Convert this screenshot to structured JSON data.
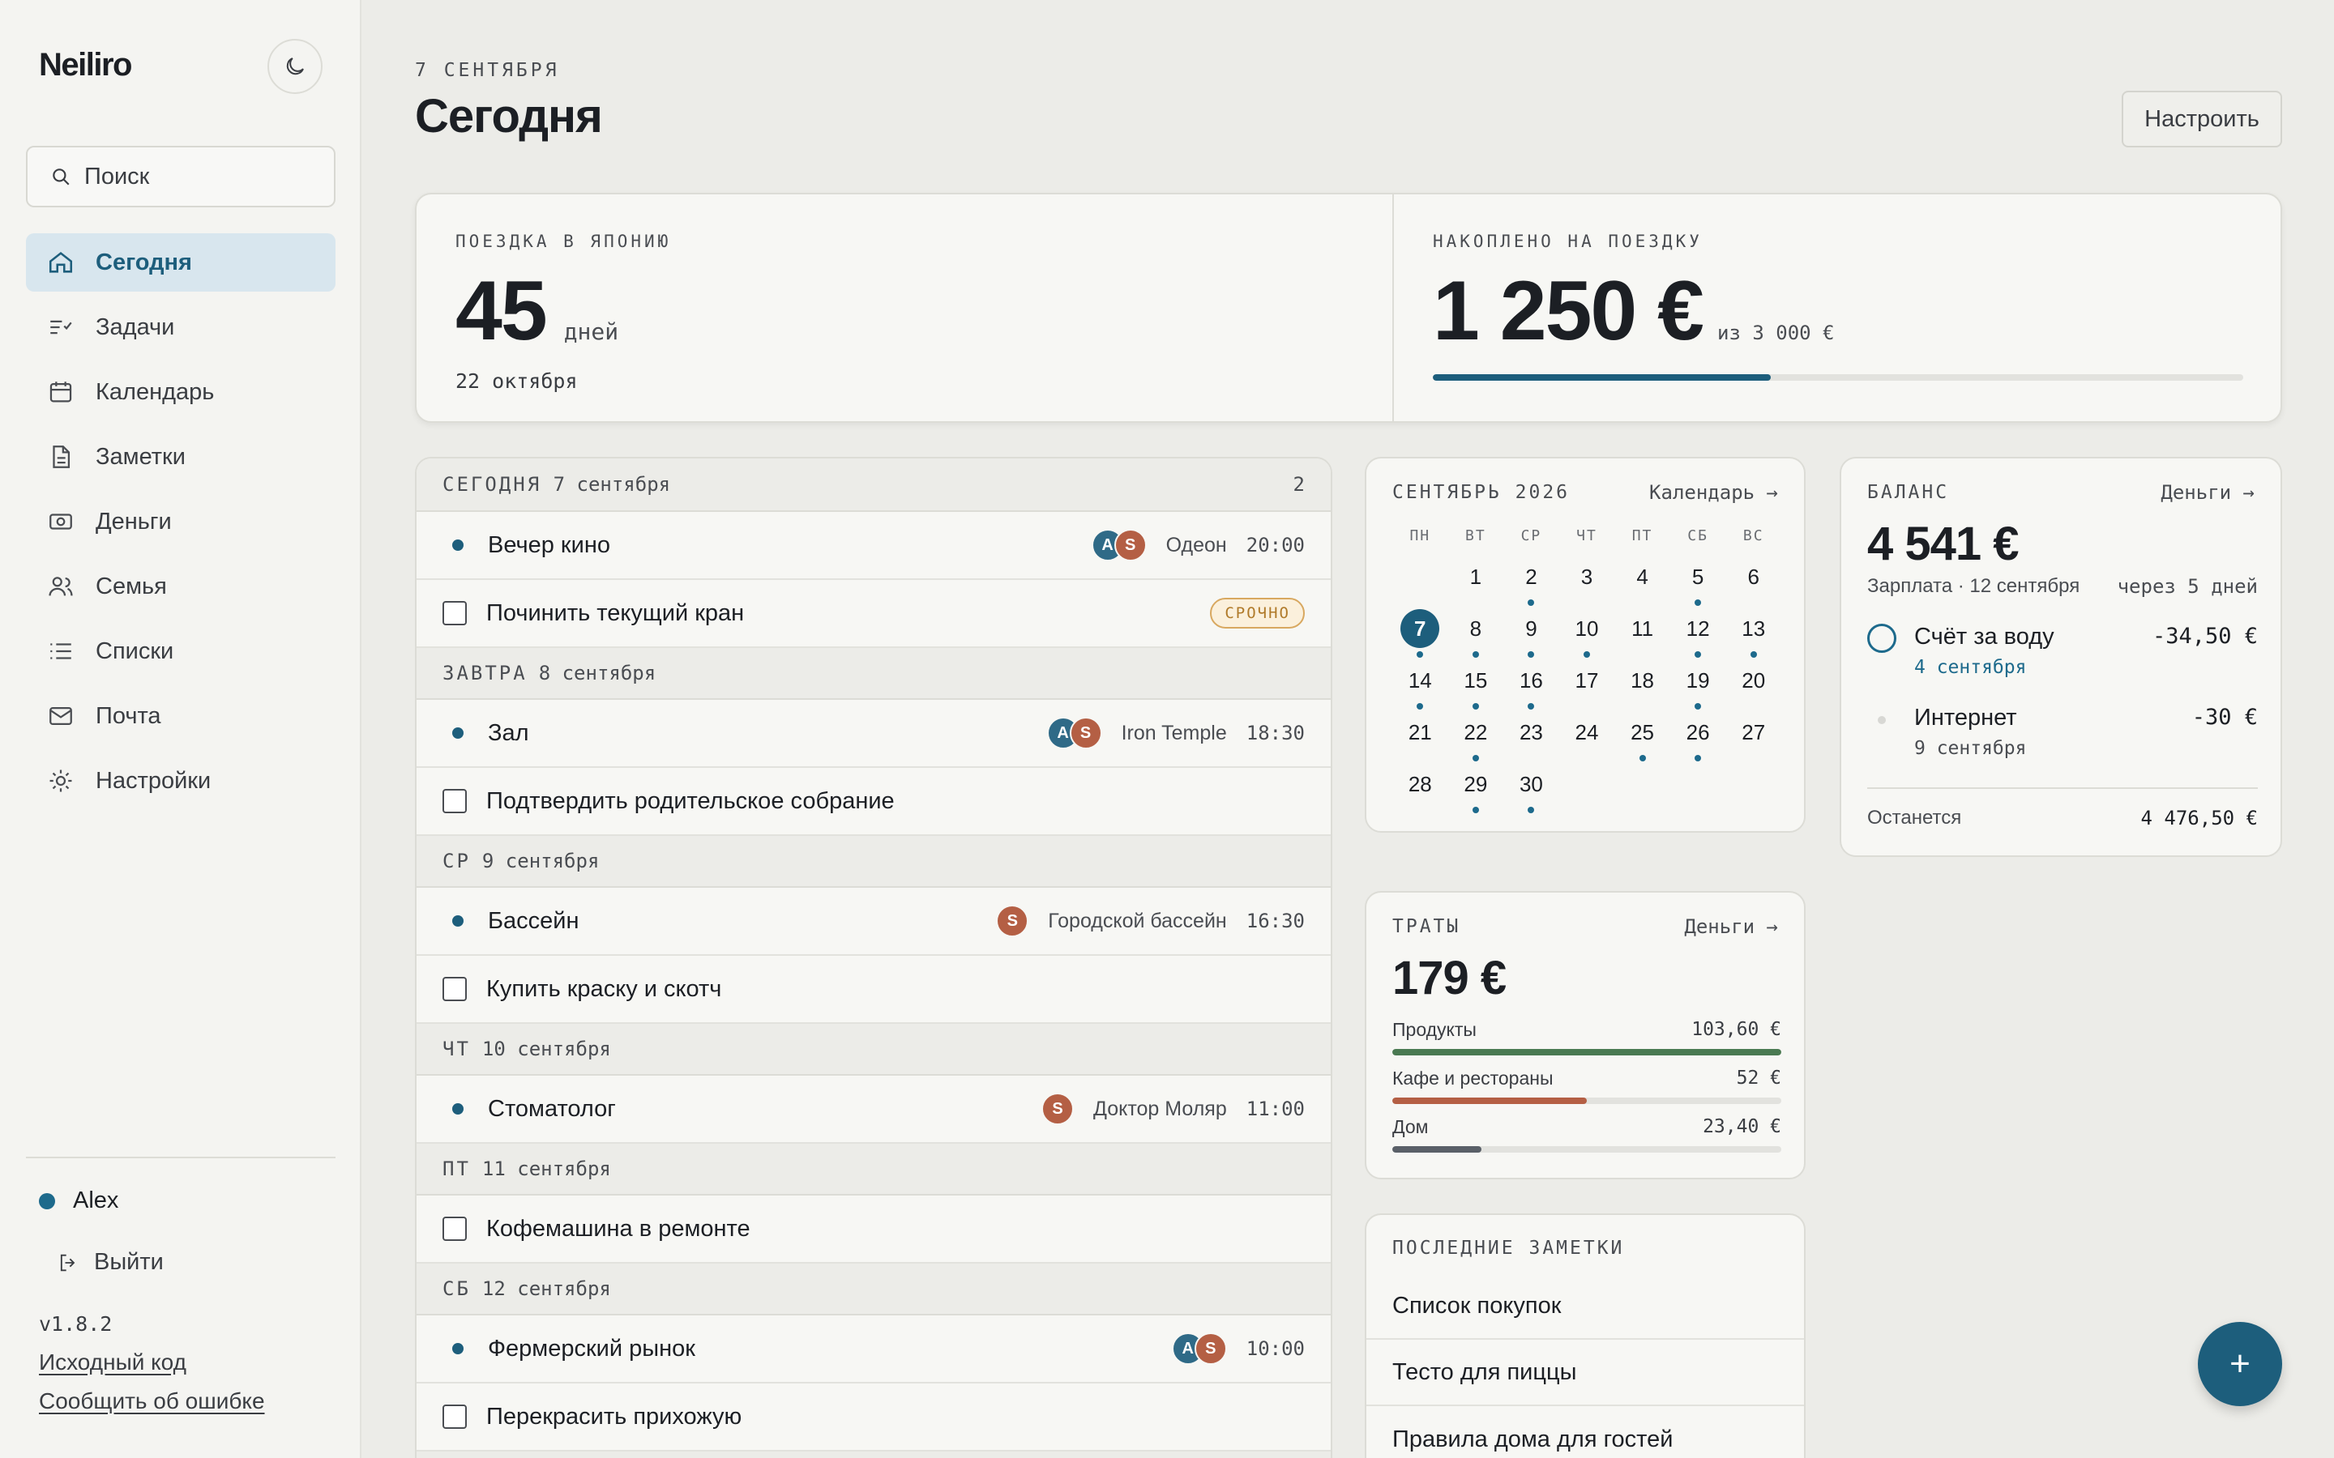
{
  "app": {
    "logo": "Neiliro"
  },
  "search": {
    "placeholder": "Поиск"
  },
  "nav": [
    {
      "label": "Сегодня",
      "icon": "home-icon"
    },
    {
      "label": "Задачи",
      "icon": "tasks-icon"
    },
    {
      "label": "Календарь",
      "icon": "calendar-icon"
    },
    {
      "label": "Заметки",
      "icon": "note-icon"
    },
    {
      "label": "Деньги",
      "icon": "money-icon"
    },
    {
      "label": "Семья",
      "icon": "family-icon"
    },
    {
      "label": "Списки",
      "icon": "list-icon"
    },
    {
      "label": "Почта",
      "icon": "mail-icon"
    },
    {
      "label": "Настройки",
      "icon": "settings-icon"
    }
  ],
  "user": {
    "name": "Alex",
    "logout": "Выйти"
  },
  "footer": {
    "version": "v1.8.2",
    "source": "Исходный код",
    "report": "Сообщить об ошибке"
  },
  "header": {
    "date": "7 СЕНТЯБРЯ",
    "title": "Сегодня",
    "configure": "Настроить"
  },
  "trip": {
    "kicker": "ПОЕЗДКА В ЯПОНИЮ",
    "days": "45",
    "unit": "дней",
    "date": "22 октября"
  },
  "savings": {
    "kicker": "НАКОПЛЕНО НА ПОЕЗДКУ",
    "amount": "1 250 €",
    "of": "из 3 000 €",
    "progress": 0.417
  },
  "agenda": {
    "head_kicker": "СЕГОДНЯ",
    "head_date": "7 сентября",
    "count": "2",
    "r1": {
      "title": "Вечер кино",
      "place": "Одеон",
      "time": "20:00"
    },
    "r2": {
      "title": "Починить текущий кран",
      "badge": "СРОЧНО"
    },
    "d2": {
      "k": "ЗАВТРА",
      "d": "8 сентября"
    },
    "r3": {
      "title": "Зал",
      "place": "Iron Temple",
      "time": "18:30"
    },
    "r4": {
      "title": "Подтвердить родительское собрание"
    },
    "d3": {
      "k": "СР",
      "d": "9 сентября"
    },
    "r5": {
      "title": "Бассейн",
      "place": "Городской бассейн",
      "time": "16:30"
    },
    "r6": {
      "title": "Купить краску и скотч"
    },
    "d4": {
      "k": "ЧТ",
      "d": "10 сентября"
    },
    "r7": {
      "title": "Стоматолог",
      "place": "Доктор Моляр",
      "time": "11:00"
    },
    "d5": {
      "k": "ПТ",
      "d": "11 сентября"
    },
    "r8": {
      "title": "Кофемашина в ремонте"
    },
    "d6": {
      "k": "СБ",
      "d": "12 сентября"
    },
    "r9": {
      "title": "Фермерский рынок",
      "time": "10:00"
    },
    "r10": {
      "title": "Перекрасить прихожую"
    },
    "av_a": "A",
    "av_s": "S"
  },
  "calendar": {
    "title": "СЕНТЯБРЬ 2026",
    "link": "Календарь →",
    "weekdays": [
      "ПН",
      "ВТ",
      "СР",
      "ЧТ",
      "ПТ",
      "СБ",
      "ВС"
    ],
    "offset": 1,
    "days_in_month": 30,
    "today": 7,
    "event_days": [
      2,
      5,
      7,
      8,
      9,
      10,
      12,
      13,
      14,
      15,
      16,
      19,
      22,
      25,
      26,
      29,
      30
    ]
  },
  "balance": {
    "kicker": "БАЛАНС",
    "link": "Деньги →",
    "amount": "4 541 €",
    "salary": "Зарплата · 12 сентября",
    "in_days": "через 5 дней",
    "b1": {
      "title": "Счёт за воду",
      "date": "4 сентября",
      "amount": "-34,50 €"
    },
    "b2": {
      "title": "Интернет",
      "date": "9 сентября",
      "amount": "-30 €"
    },
    "rest_label": "Останется",
    "rest_value": "4 476,50 €"
  },
  "spending": {
    "kicker": "ТРАТЫ",
    "link": "Деньги →",
    "amount": "179 €",
    "cats": [
      {
        "label": "Продукты",
        "value": "103,60 €",
        "fill": 1.0,
        "color": "#4a7a52"
      },
      {
        "label": "Кафе и рестораны",
        "value": "52 €",
        "fill": 0.5,
        "color": "#b45f44"
      },
      {
        "label": "Дом",
        "value": "23,40 €",
        "fill": 0.23,
        "color": "#5a6068"
      }
    ]
  },
  "notes": {
    "kicker": "ПОСЛЕДНИЕ ЗАМЕТКИ",
    "items": [
      "Список покупок",
      "Тесто для пиццы",
      "Правила дома для гостей"
    ]
  },
  "fab": {
    "label": "+"
  }
}
